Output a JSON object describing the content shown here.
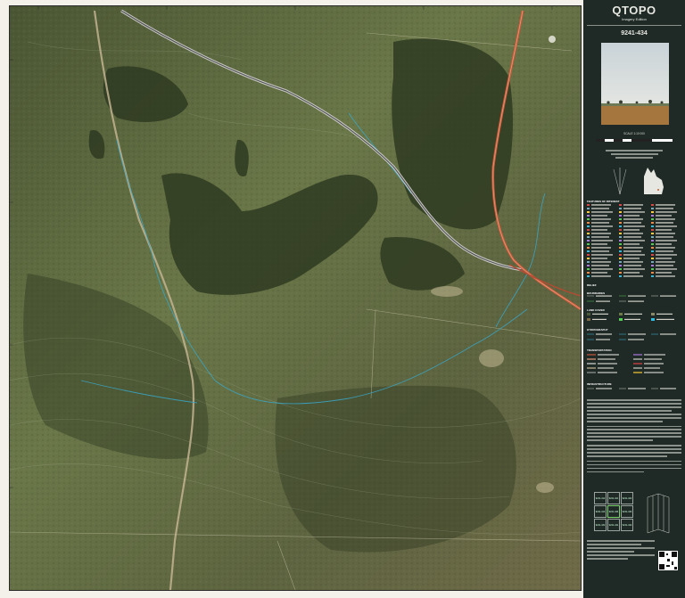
{
  "sidebar": {
    "title": "QTOPO",
    "subtitle": "Imagery Edition",
    "map_number": "9241-434",
    "scale": "SCALE 1:10 000",
    "legend_heading": "FEATURES OF INTEREST",
    "section_relief": "RELIEF",
    "section_boundaries": "BOUNDARIES",
    "section_landcover": "LAND COVER",
    "section_hydrography": "HYDROGRAPHY",
    "section_transportation": "TRANSPORTATION",
    "section_infrastructure": "INFRASTRUCTURE",
    "index_cells": [
      [
        "9241-412",
        "9241-421",
        "9241-422"
      ],
      [
        "9241-414",
        "9241-434",
        "9241-443"
      ],
      [
        "9241-432",
        "9241-441",
        "9241-442"
      ]
    ]
  },
  "colors": {
    "imagery_dark": "#3c4a2a",
    "imagery_light": "#7d8a55",
    "road": "#c85a3a",
    "stream": "#3aa7c9",
    "sidebar_bg": "#1f2a26"
  }
}
